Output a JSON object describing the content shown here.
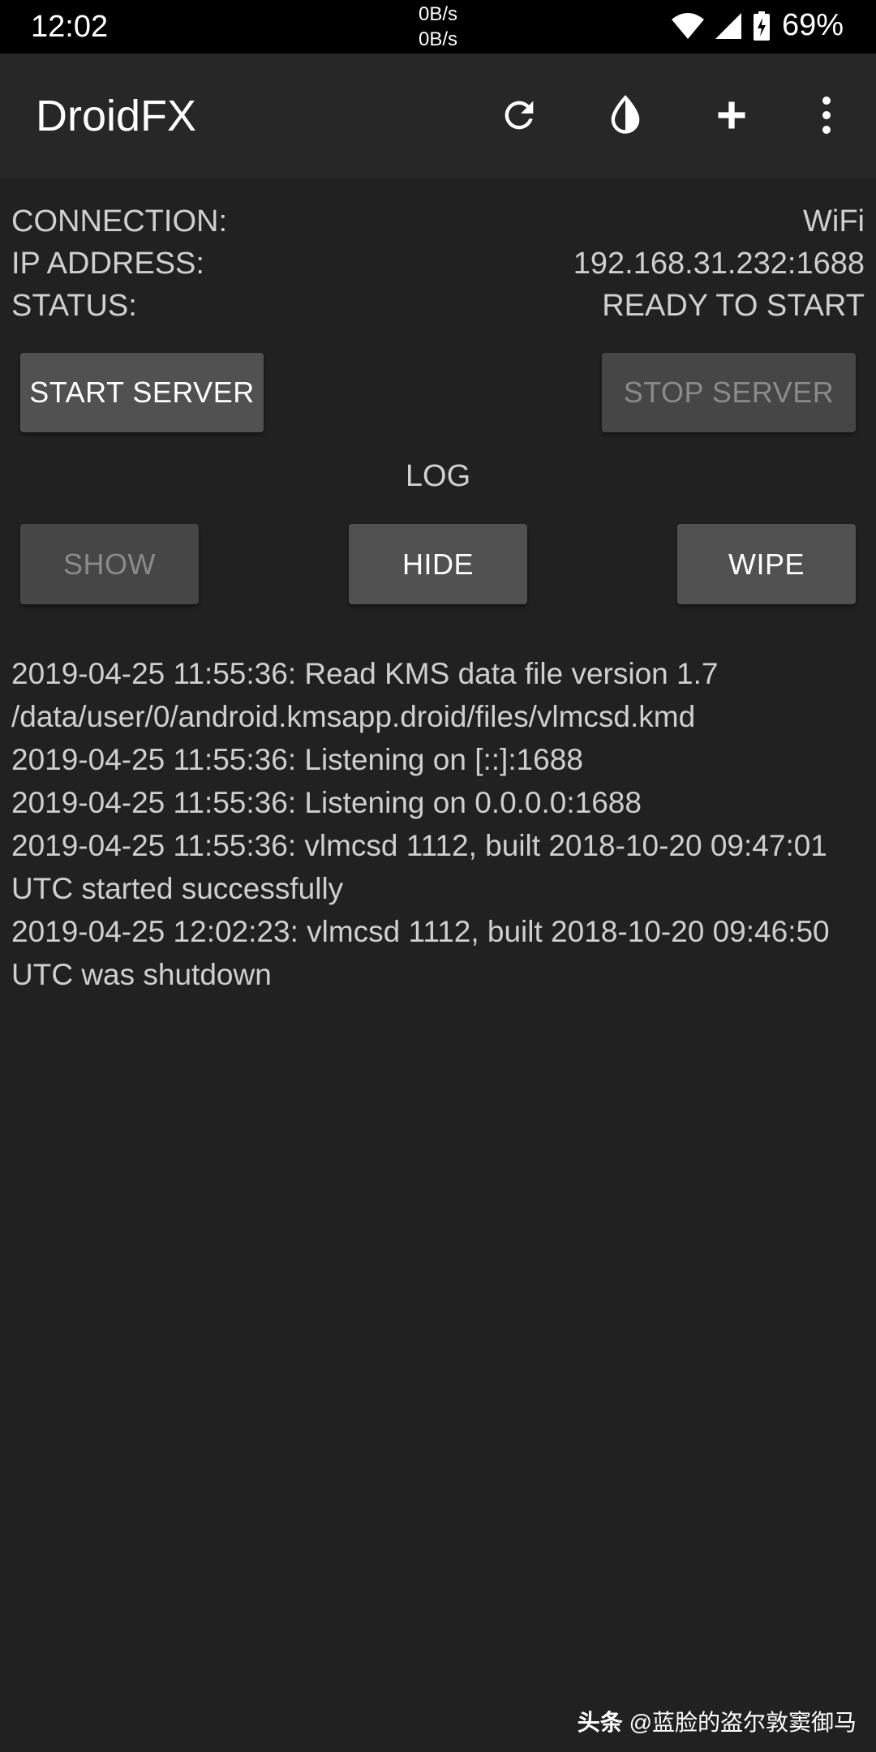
{
  "status_bar": {
    "time": "12:02",
    "net_up": "0B/s",
    "net_down": "0B/s",
    "battery": "69%",
    "icons": [
      "wifi-icon",
      "signal-icon",
      "battery-charging-icon"
    ]
  },
  "app_bar": {
    "title": "DroidFX",
    "actions": [
      "refresh-icon",
      "theme-contrast-icon",
      "add-icon",
      "overflow-menu-icon"
    ]
  },
  "info": {
    "connection_label": "CONNECTION:",
    "connection_value": "WiFi",
    "ip_label": "IP ADDRESS:",
    "ip_value": "192.168.31.232:1688",
    "status_label": "STATUS:",
    "status_value": "READY TO START"
  },
  "server_buttons": {
    "start": "START SERVER",
    "stop": "STOP SERVER",
    "stop_disabled": true
  },
  "log": {
    "title": "LOG",
    "show": "SHOW",
    "show_disabled": true,
    "hide": "HIDE",
    "wipe": "WIPE",
    "lines": [
      "2019-04-25 11:55:36: Read KMS data file version 1.7 /data/user/0/android.kmsapp.droid/files/vlmcsd.kmd",
      "2019-04-25 11:55:36: Listening on [::]:1688",
      "2019-04-25 11:55:36: Listening on 0.0.0.0:1688",
      "2019-04-25 11:55:36: vlmcsd 1112, built 2018-10-20 09:47:01 UTC started successfully",
      "2019-04-25 12:02:23: vlmcsd 1112, built 2018-10-20 09:46:50 UTC was shutdown"
    ]
  },
  "watermark": {
    "brand": "头条",
    "handle": "@蓝脸的盗尔敦窦御马"
  },
  "colors": {
    "background": "#212121",
    "app_bar": "#272727",
    "button": "#515151",
    "button_disabled": "#464646"
  }
}
